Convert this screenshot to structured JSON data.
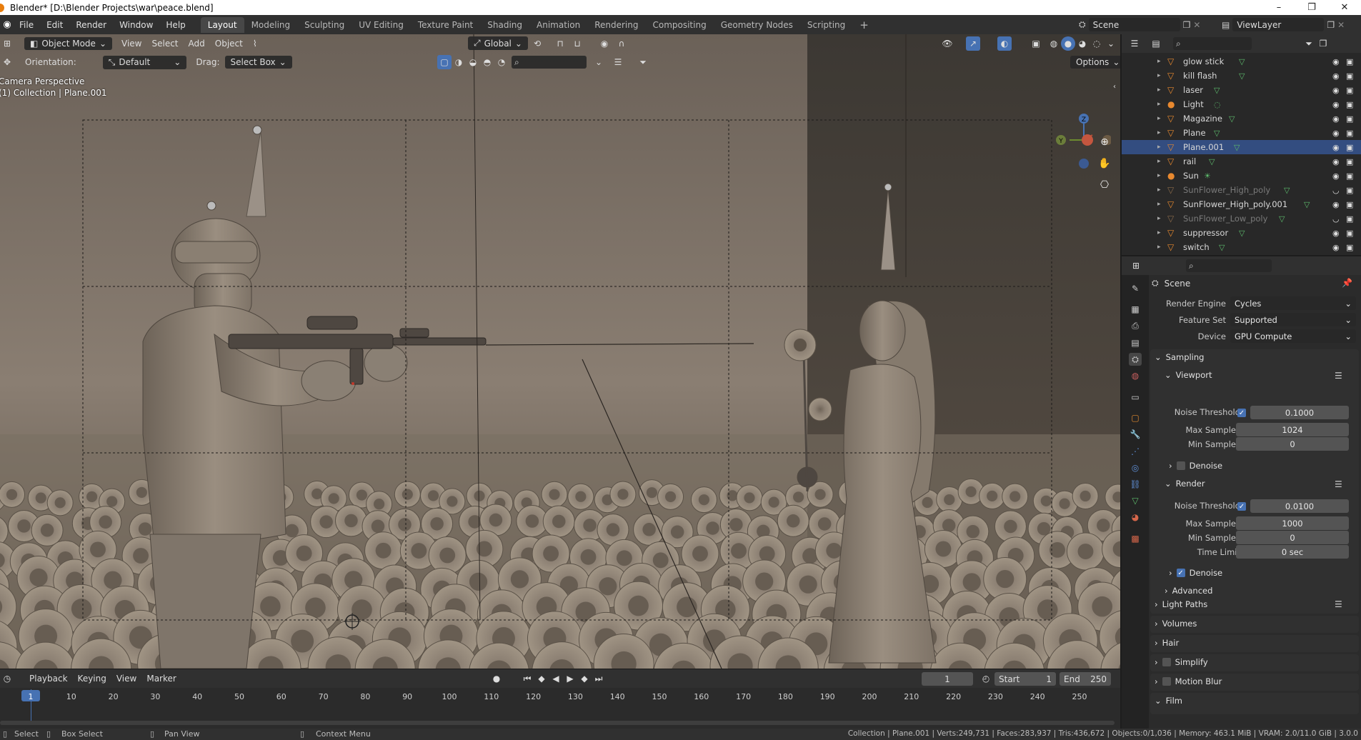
{
  "window": {
    "title": "Blender* [D:\\Blender Projects\\war\\peace.blend]",
    "minimize": "–",
    "maximize": "❐",
    "close": "✕"
  },
  "menubar": {
    "menus": [
      "File",
      "Edit",
      "Render",
      "Window",
      "Help"
    ],
    "workspaces": [
      "Layout",
      "Modeling",
      "Sculpting",
      "UV Editing",
      "Texture Paint",
      "Shading",
      "Animation",
      "Rendering",
      "Compositing",
      "Geometry Nodes",
      "Scripting"
    ],
    "active_workspace": "Layout",
    "add_tab": "+",
    "scene": "Scene",
    "view_layer": "ViewLayer"
  },
  "viewport": {
    "mode": "Object Mode",
    "menus": [
      "View",
      "Select",
      "Add",
      "Object"
    ],
    "transform_space": "Global",
    "orientation_label": "Orientation:",
    "orientation_value": "Default",
    "drag_label": "Drag:",
    "drag_value": "Select Box",
    "options": "Options",
    "camera_text": "Camera Perspective",
    "collection_text": "(1) Collection | Plane.001",
    "gizmo_z": "Z",
    "gizmo_y": "Y",
    "accent": "#4772b3",
    "bg_color": "#5a5249"
  },
  "timeline": {
    "menus": [
      "Playback",
      "Keying",
      "View",
      "Marker"
    ],
    "current_frame": "1",
    "start_label": "Start",
    "start": "1",
    "end_label": "End",
    "end": "250",
    "ticks": [
      "1",
      "10",
      "20",
      "30",
      "40",
      "50",
      "60",
      "70",
      "80",
      "90",
      "100",
      "110",
      "120",
      "130",
      "140",
      "150",
      "160",
      "170",
      "180",
      "190",
      "200",
      "210",
      "220",
      "230",
      "240",
      "250"
    ]
  },
  "outliner": {
    "items": [
      {
        "name": "glow stick",
        "icon": "mesh-object-icon",
        "dim": false,
        "selected": false
      },
      {
        "name": "kill flash",
        "icon": "mesh-object-icon",
        "dim": false,
        "selected": false
      },
      {
        "name": "laser",
        "icon": "mesh-object-icon",
        "dim": false,
        "selected": false
      },
      {
        "name": "Light",
        "icon": "light-icon",
        "dim": false,
        "selected": false
      },
      {
        "name": "Magazine",
        "icon": "mesh-object-icon",
        "dim": false,
        "selected": false
      },
      {
        "name": "Plane",
        "icon": "mesh-object-icon",
        "dim": false,
        "selected": false
      },
      {
        "name": "Plane.001",
        "icon": "mesh-object-icon",
        "dim": false,
        "selected": true
      },
      {
        "name": "rail",
        "icon": "mesh-object-icon",
        "dim": false,
        "selected": false
      },
      {
        "name": "Sun",
        "icon": "sun-light-icon",
        "dim": false,
        "selected": false
      },
      {
        "name": "SunFlower_High_poly",
        "icon": "mesh-object-icon",
        "dim": true,
        "selected": false
      },
      {
        "name": "SunFlower_High_poly.001",
        "icon": "mesh-object-icon",
        "dim": false,
        "selected": false
      },
      {
        "name": "SunFlower_Low_poly",
        "icon": "mesh-object-icon",
        "dim": true,
        "selected": false
      },
      {
        "name": "suppressor",
        "icon": "mesh-object-icon",
        "dim": false,
        "selected": false
      },
      {
        "name": "switch",
        "icon": "mesh-object-icon",
        "dim": false,
        "selected": false
      }
    ]
  },
  "properties": {
    "context": "Scene",
    "render_engine_label": "Render Engine",
    "render_engine": "Cycles",
    "feature_set_label": "Feature Set",
    "feature_set": "Supported",
    "device_label": "Device",
    "device": "GPU Compute",
    "sampling": "Sampling",
    "viewport": "Viewport",
    "noise_threshold_label": "Noise Threshold",
    "vp_noise_threshold": "0.1000",
    "max_samples_label": "Max Samples",
    "vp_max_samples": "1024",
    "min_samples_label": "Min Samples",
    "vp_min_samples": "0",
    "denoise": "Denoise",
    "render": "Render",
    "r_noise_threshold": "0.0100",
    "r_max_samples": "1000",
    "r_min_samples": "0",
    "time_limit_label": "Time Limit",
    "time_limit": "0 sec",
    "advanced": "Advanced",
    "light_paths": "Light Paths",
    "volumes": "Volumes",
    "hair": "Hair",
    "simplify": "Simplify",
    "motion_blur": "Motion Blur",
    "film": "Film"
  },
  "statusbar": {
    "select": "Select",
    "box_select": "Box Select",
    "pan_view": "Pan View",
    "context_menu": "Context Menu",
    "stats": "Collection | Plane.001 | Verts:249,731 | Faces:283,937 | Tris:436,672 | Objects:0/1,036 | Memory: 463.1 MiB | VRAM: 2.0/11.0 GiB | 3.0.0"
  }
}
